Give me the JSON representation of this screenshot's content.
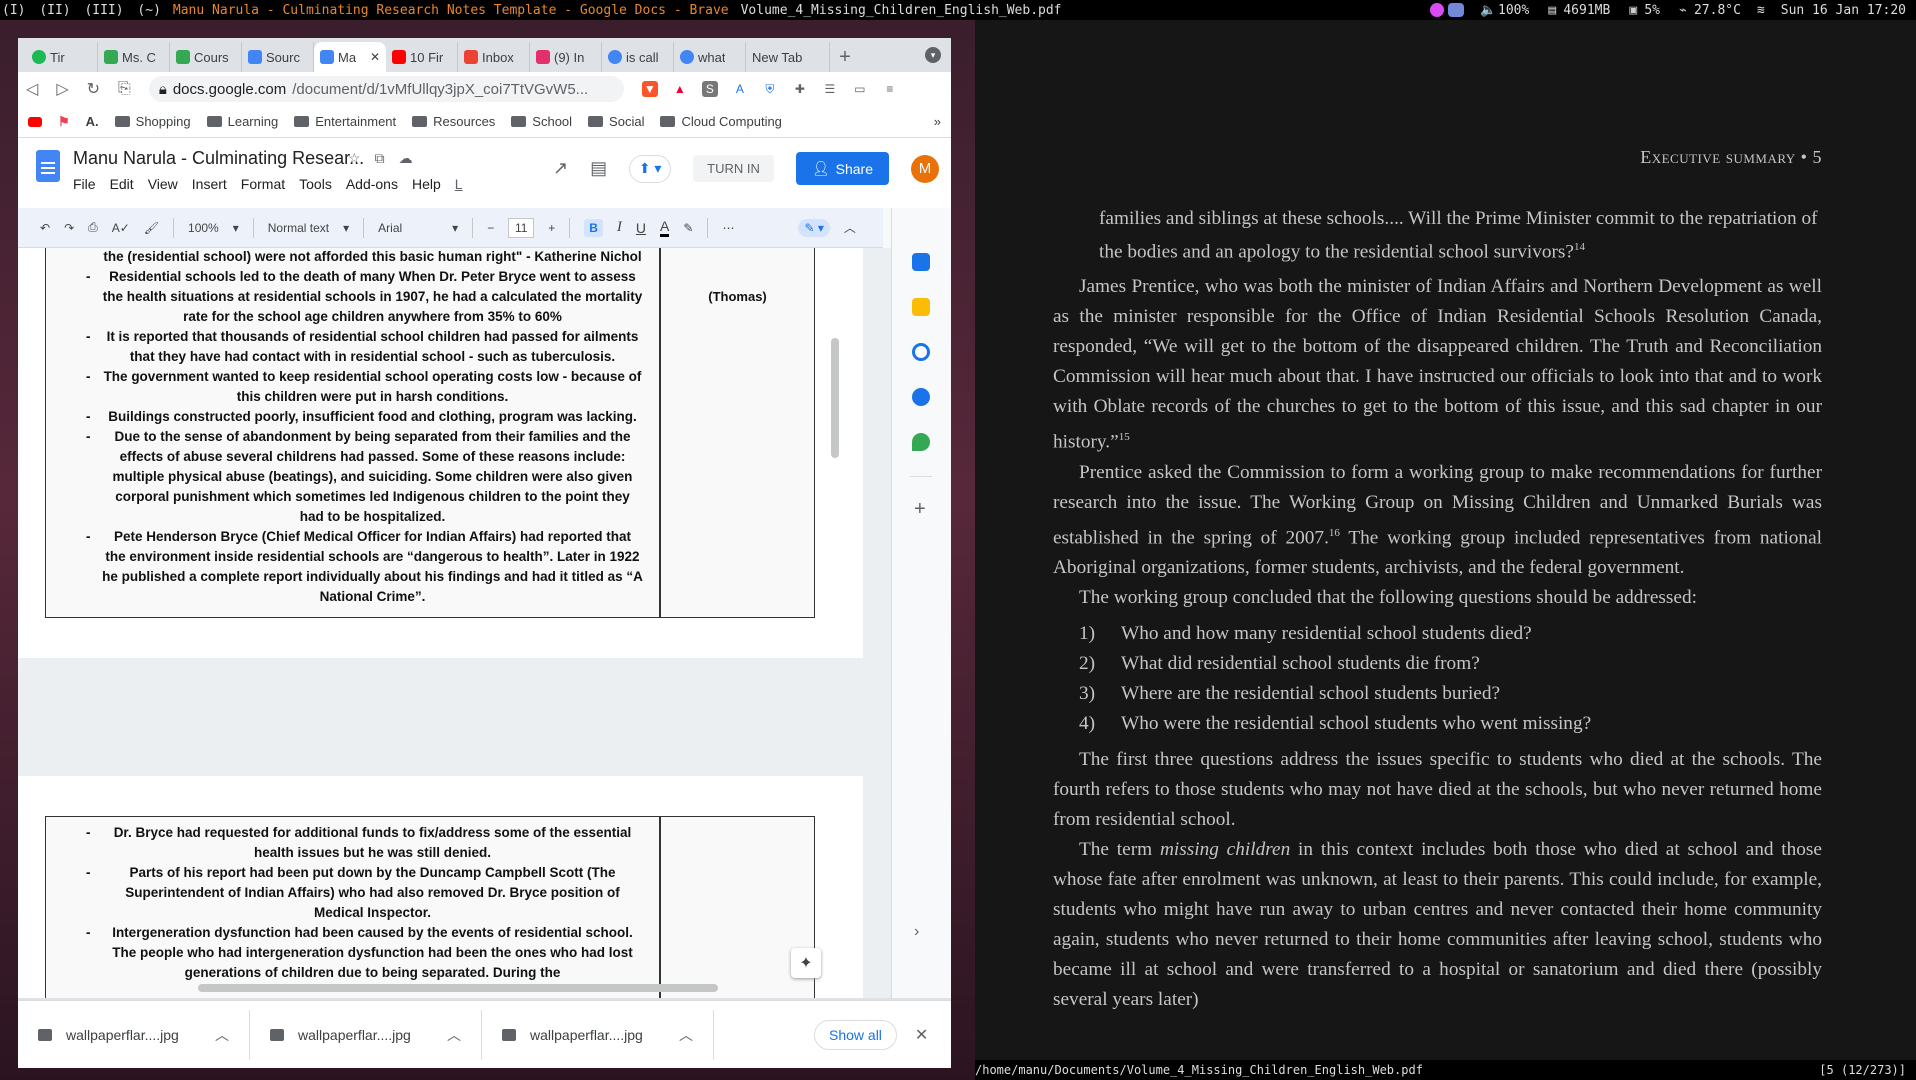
{
  "topbar": {
    "workspaces": [
      "(I)",
      "(II)",
      "(III)",
      "(~)"
    ],
    "window_title": "Manu Narula - Culminating Research Notes Template - Google Docs - Brave",
    "pdf_title": "Volume_4_Missing_Children_English_Web.pdf",
    "volume": "100%",
    "memory": "4691MB",
    "cpu": "5%",
    "temp": "27.8°C",
    "datetime": "Sun 16 Jan 17:20"
  },
  "browser": {
    "tabs": [
      {
        "label": "Tir",
        "color": "#1db954"
      },
      {
        "label": "Ms. C",
        "color": "#34a853"
      },
      {
        "label": "Cours",
        "color": "#34a853"
      },
      {
        "label": "Sourc",
        "color": "#4285f4"
      },
      {
        "label": "Ma",
        "color": "#4285f4"
      },
      {
        "label": "10 Fir",
        "color": "#ff0000"
      },
      {
        "label": "Inbox",
        "color": "#ea4335"
      },
      {
        "label": "(9) In",
        "color": "#e1306c"
      },
      {
        "label": "is call",
        "color": "#4285f4"
      },
      {
        "label": "what",
        "color": "#4285f4"
      },
      {
        "label": "New Tab",
        "color": ""
      }
    ],
    "url_host": "docs.google.com",
    "url_path": "/document/d/1vMfUllqy3jpX_coi7TtVGvW5...",
    "bookmarks": [
      "Shopping",
      "Learning",
      "Entertainment",
      "Resources",
      "School",
      "Social",
      "Cloud Computing"
    ]
  },
  "docs": {
    "title": "Manu Narula - Culminating Resear...",
    "menu": [
      "File",
      "Edit",
      "View",
      "Insert",
      "Format",
      "Tools",
      "Add-ons",
      "Help",
      "L"
    ],
    "turn_in": "TURN IN",
    "share": "Share",
    "avatar": "M",
    "zoom": "100%",
    "style": "Normal text",
    "font": "Arial",
    "font_size": "11",
    "page1_bullets": [
      "the (residential school) were not afforded this basic human right\" - Katherine Nichol",
      "Residential schools led to the death of many When Dr. Peter Bryce went to assess the health situations at residential schools in  1907, he had a calculated the mortality rate for the school age children anywhere from 35% to 60%",
      "It is reported that thousands of residential school children had passed for ailments that they have had contact with in residential school - such as tuberculosis.",
      "The government wanted to keep residential school operating costs low - because of this children were put in harsh conditions.",
      "Buildings constructed poorly, insufficient food and clothing, program was lacking.",
      "Due to the sense of abandonment by being separated from their families and the effects of abuse several childrens had passed. Some of these reasons include: multiple physical abuse (beatings), and suiciding. Some children were also given corporal punishment which sometimes led Indigenous children to the point they had to be hospitalized.",
      "Pete Henderson Bryce (Chief Medical Officer for Indian Affairs) had reported that the environment inside residential schools are “dangerous to health”. Later in 1922 he published a complete report individually about his findings and had it titled as “A National Crime”."
    ],
    "citation": "(Thomas)",
    "page2_bullets": [
      "Dr. Bryce had requested for additional funds to fix/address some of the essential health issues but he was still denied.",
      "Parts of his report had been put down by the Duncamp Campbell Scott (The Superintendent of Indian Affairs) who had also removed Dr. Bryce position of Medical Inspector.",
      "Intergeneration dysfunction had been caused by the events of residential school. The people who had intergeneration dysfunction had been the ones who had lost generations of children due to being separated. During the"
    ]
  },
  "downloads": {
    "items": [
      "wallpaperflar....jpg",
      "wallpaperflar....jpg",
      "wallpaperflar....jpg"
    ],
    "show_all": "Show all"
  },
  "pdf": {
    "running_head": "Executive summary • 5",
    "quote": "families and siblings at these schools.... Will the Prime Minister commit to the repatriation of the bodies and an apology to the residential school survivors?",
    "quote_note": "14",
    "para1": "James Prentice, who was both the minister of Indian Affairs and Northern Development as well as the minister responsible for the Office of Indian Residential Schools Resolution Canada, responded, “We will get to the bottom of the disappeared children. The Truth and Reconciliation Commission will hear much about that. I have instructed our officials to look into that and to work with Oblate records of the churches to get to the bottom of this issue, and this sad chapter in our history.”",
    "para1_note": "15",
    "para2a": "Prentice asked the Commission to form a working group to make recommendations for further research into the issue. The Working Group on Missing Children and Unmarked Burials was established in the spring of 2007.",
    "para2_note": "16",
    "para2b": " The working group included representatives from national Aboriginal organizations, former students, archivists, and the federal government.",
    "para3": "The working group concluded that the following questions should be addressed:",
    "questions": [
      "Who and how many residential school students died?",
      "What did residential school students die from?",
      "Where are the residential school students buried?",
      "Who were the residential school students who went missing?"
    ],
    "para4": "The first three questions address the issues specific to students who died at the schools. The fourth refers to those students who may not have died at the schools, but who never returned home from residential school.",
    "para5a": "The term ",
    "para5_em": "missing children",
    "para5b": " in this context includes both those who died at school and those whose fate after enrolment was unknown, at least to their parents. This could include, for example, students who might have run away to urban centres and never contacted their home community again, students who never returned to their home communities after leaving school, students who became ill at school and were transferred to a hospital or sanatorium and died there (possibly several years later)",
    "status_path": "/home/manu/Documents/Volume_4_Missing_Children_English_Web.pdf",
    "status_page": "[5 (12/273)]"
  }
}
